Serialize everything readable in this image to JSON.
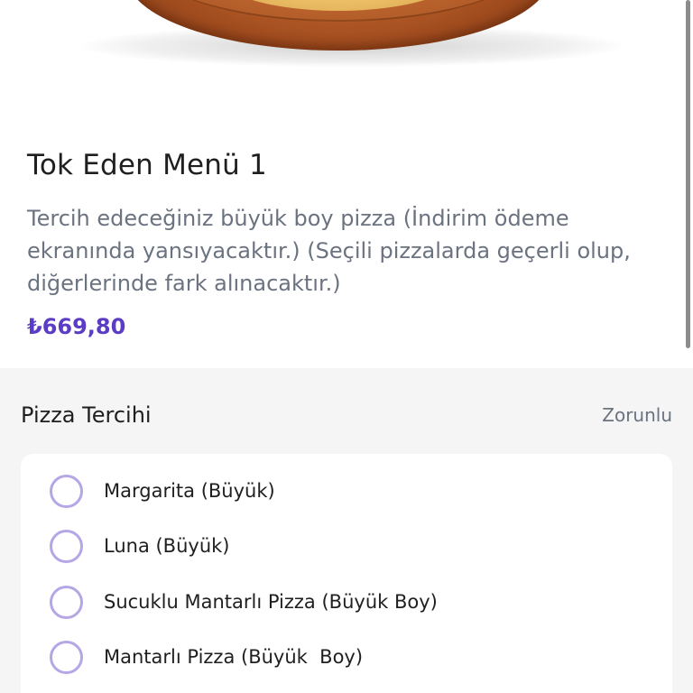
{
  "product": {
    "title": "Tok Eden Menü 1",
    "description": "Tercih edeceğiniz büyük boy pizza (İndirim ödeme ekranında yansıyacaktır.) (Seçili pizzalarda geçerli olup, diğerlerinde fark alınacaktır.)",
    "price": "₺669,80"
  },
  "option_group": {
    "title": "Pizza Tercihi",
    "required_label": "Zorunlu",
    "options": [
      {
        "label": "Margarita (Büyük)",
        "selected": false
      },
      {
        "label": "Luna (Büyük)",
        "selected": false
      },
      {
        "label": "Sucuklu Mantarlı Pizza (Büyük Boy)",
        "selected": false
      },
      {
        "label": "Mantarlı Pizza (Büyük  Boy)",
        "selected": false
      }
    ]
  },
  "colors": {
    "price": "#5b3cc4",
    "radio_border": "#b5a6e6",
    "section_bg": "#f5f5f5"
  }
}
